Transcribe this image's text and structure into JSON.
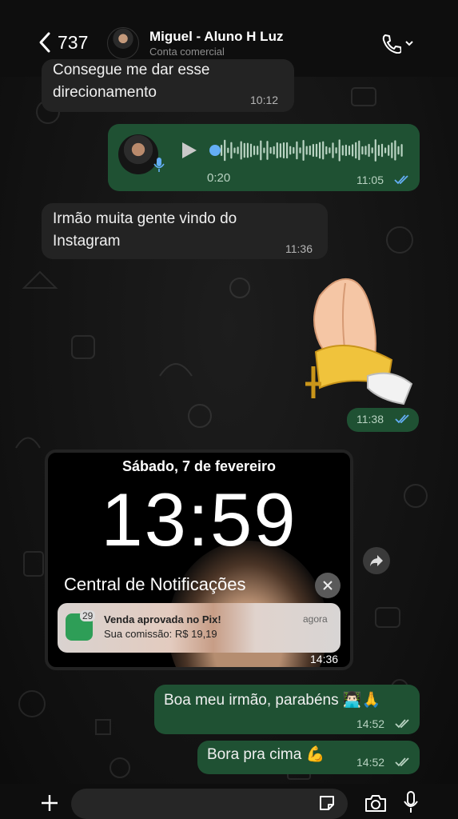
{
  "header": {
    "back_count": "737",
    "contact_name": "Miguel  - Aluno H Luz",
    "contact_subtitle": "Conta comercial"
  },
  "messages": {
    "m1": {
      "text_line1": "Consegue me dar esse",
      "text_line2": "direcionamento",
      "time": "10:12"
    },
    "audio": {
      "duration": "0:20",
      "time": "11:05"
    },
    "m2": {
      "text_line1": "Irmão muita gente vindo do",
      "text_line2": "Instagram",
      "time": "11:36"
    },
    "sticker": {
      "time": "11:38"
    },
    "screenshot": {
      "date": "Sábado, 7 de fevereiro",
      "clock": "13:59",
      "notification_center": "Central de Notificações",
      "notif_badge": "29",
      "notif_title": "Venda aprovada no Pix!",
      "notif_body": "Sua comissão: R$ 19,19",
      "notif_time": "agora",
      "time": "14:36"
    },
    "m3": {
      "text": "Boa meu irmão, parabéns 👨🏻‍💻🙏",
      "time": "14:52"
    },
    "m4": {
      "text": "Bora pra cima 💪",
      "time": "14:52"
    }
  },
  "colors": {
    "incoming_bubble": "#232323",
    "outgoing_bubble": "#1f5133",
    "read_ticks": "#64aef5"
  },
  "icons": [
    "back-chevron-icon",
    "phone-icon",
    "chevron-down-icon",
    "play-icon",
    "mic-icon",
    "double-check-icon",
    "forward-icon",
    "close-icon",
    "plus-icon",
    "sticker-icon",
    "camera-icon"
  ]
}
